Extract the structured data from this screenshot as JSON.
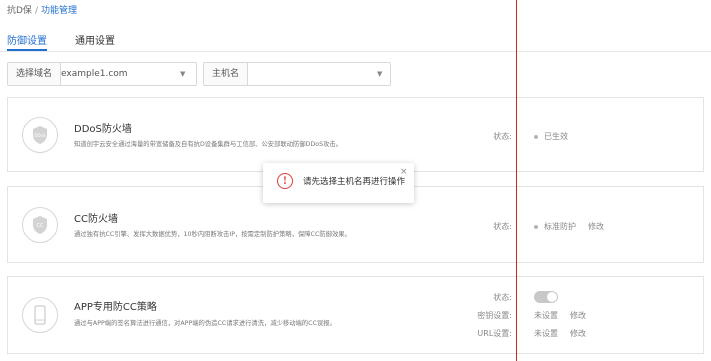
{
  "breadcrumb": {
    "root": "抗D保",
    "separator": "/",
    "current": "功能管理"
  },
  "tabs": [
    {
      "label": "防御设置",
      "active": true
    },
    {
      "label": "通用设置",
      "active": false
    }
  ],
  "filters": {
    "domain": {
      "label": "选择域名",
      "value": "example1.com"
    },
    "host": {
      "label": "主机名",
      "value": ""
    }
  },
  "cards": {
    "ddos": {
      "badge": "DDoS",
      "title": "DDoS防火墙",
      "description": "知道创宇云安全通过海量的带宽储备及自有抗D设备集群与工信部、公安部联动防御DDoS攻击。",
      "status_label": "状态:",
      "status_value": "已生效"
    },
    "cc": {
      "badge": "CC",
      "title": "CC防火墙",
      "description": "通过独有抗CC引擎、发挥大数据优势，10秒内阻断攻击IP，按需定制防护策略，保障CC防御效果。",
      "status_label": "状态:",
      "status_value": "标准防护",
      "edit_label": "修改"
    },
    "app": {
      "title": "APP专用防CC策略",
      "description": "通过与APP端的签名算法进行通信，对APP端的伪造CC请求进行清洗，减少移动端的CC误报。",
      "status_label": "状态:",
      "toggle_on": false,
      "key_label": "密钥设置:",
      "key_value": "未设置",
      "key_edit": "修改",
      "url_label": "URL设置:",
      "url_value": "未设置",
      "url_edit": "修改"
    }
  },
  "toast": {
    "message": "请先选择主机名再进行操作",
    "close": "×",
    "icon": "!"
  },
  "colors": {
    "accent": "#1f6fd1",
    "error": "#e03b3b",
    "guide_line": "#c82828"
  },
  "icons": {
    "shield": "shield-icon",
    "phone": "phone-icon",
    "caret": "caret-down-icon",
    "alert": "alert-circle-icon",
    "close": "close-icon"
  }
}
